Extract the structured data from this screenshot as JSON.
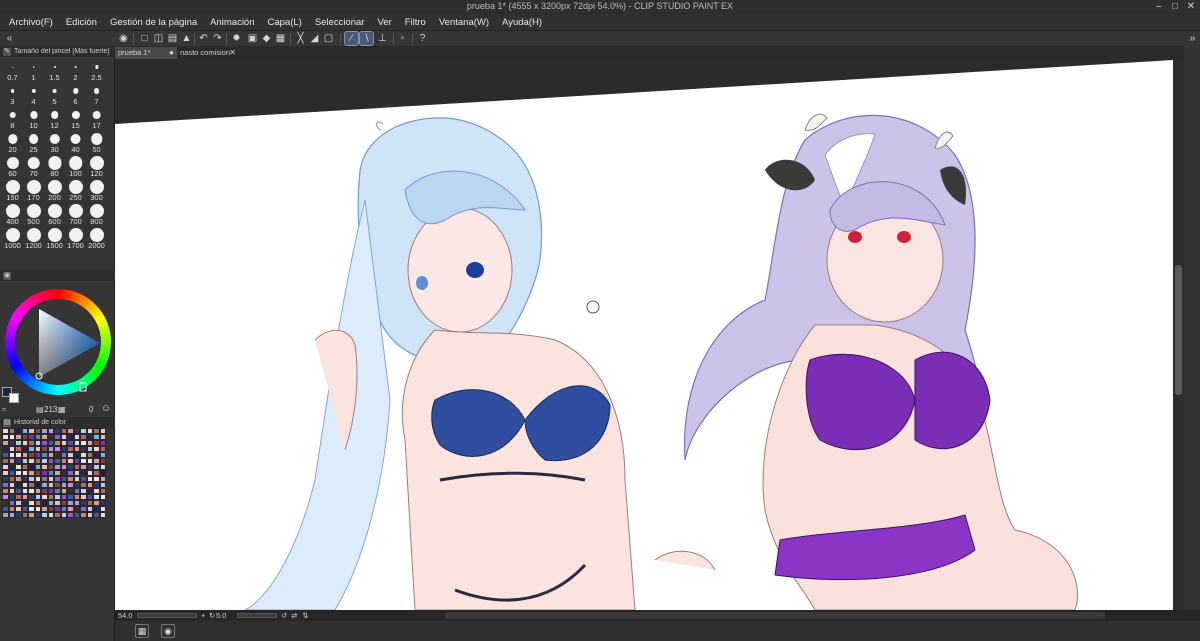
{
  "window": {
    "title": "prueba 1* (4555 x 3200px 72dpi 54.0%)  - CLIP STUDIO PAINT EX"
  },
  "menu": {
    "items": [
      "Archivo(F)",
      "Edición",
      "Gestión de la página",
      "Animación",
      "Capa(L)",
      "Seleccionar",
      "Ver",
      "Filtro",
      "Ventana(W)",
      "Ayuda(H)"
    ]
  },
  "brush_size_panel": {
    "title": "Tamaño del pincel [Más fuerte]",
    "sizes": [
      "0.7",
      "1",
      "1.5",
      "2",
      "2.5",
      "3",
      "4",
      "5",
      "6",
      "7",
      "8",
      "10",
      "12",
      "15",
      "17",
      "20",
      "25",
      "30",
      "40",
      "50",
      "60",
      "70",
      "80",
      "100",
      "120",
      "150",
      "170",
      "200",
      "250",
      "300",
      "400",
      "500",
      "600",
      "700",
      "800",
      "1000",
      "1200",
      "1500",
      "1700",
      "2000"
    ]
  },
  "color_panel": {
    "value_readout": "213",
    "opacity_readout": "0",
    "main_color": "#1c2a3c",
    "sub_color": "#ffffff"
  },
  "color_history_panel": {
    "title": "Historial de color"
  },
  "tabs": [
    {
      "label": "prueba 1*",
      "active": true
    },
    {
      "label": "nasto comision",
      "active": false
    }
  ],
  "status": {
    "zoom": "54.0",
    "angle": "5.0"
  },
  "colors": {
    "accent": "#4a5a74",
    "panel_bg": "#353535",
    "canvas_bg": "#ffffff",
    "workspace_bg": "#2b2b2b"
  }
}
